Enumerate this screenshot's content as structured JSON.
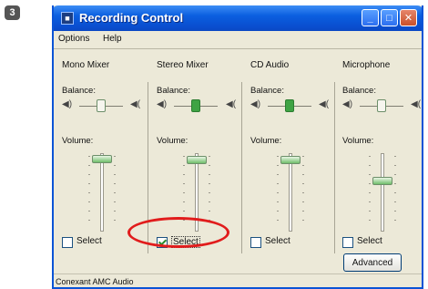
{
  "step_badge": "3",
  "window": {
    "title": "Recording Control",
    "menu": [
      "Options",
      "Help"
    ],
    "buttons": {
      "minimize": "_",
      "maximize": "□",
      "close": "✕"
    }
  },
  "labels": {
    "balance": "Balance:",
    "volume": "Volume:",
    "select": "Select"
  },
  "columns": [
    {
      "name": "Mono Mixer",
      "selected": false,
      "balance_thumb_green": false
    },
    {
      "name": "Stereo Mixer",
      "selected": true,
      "balance_thumb_green": true
    },
    {
      "name": "CD Audio",
      "selected": false,
      "balance_thumb_green": true
    },
    {
      "name": "Microphone",
      "selected": false,
      "balance_thumb_green": false
    }
  ],
  "advanced_button": "Advanced",
  "status_bar": "Conexant AMC Audio",
  "colors": {
    "title_blue": "#0b5fe0",
    "highlight_circle": "#e11c1c",
    "window_bg": "#ece9d8"
  }
}
